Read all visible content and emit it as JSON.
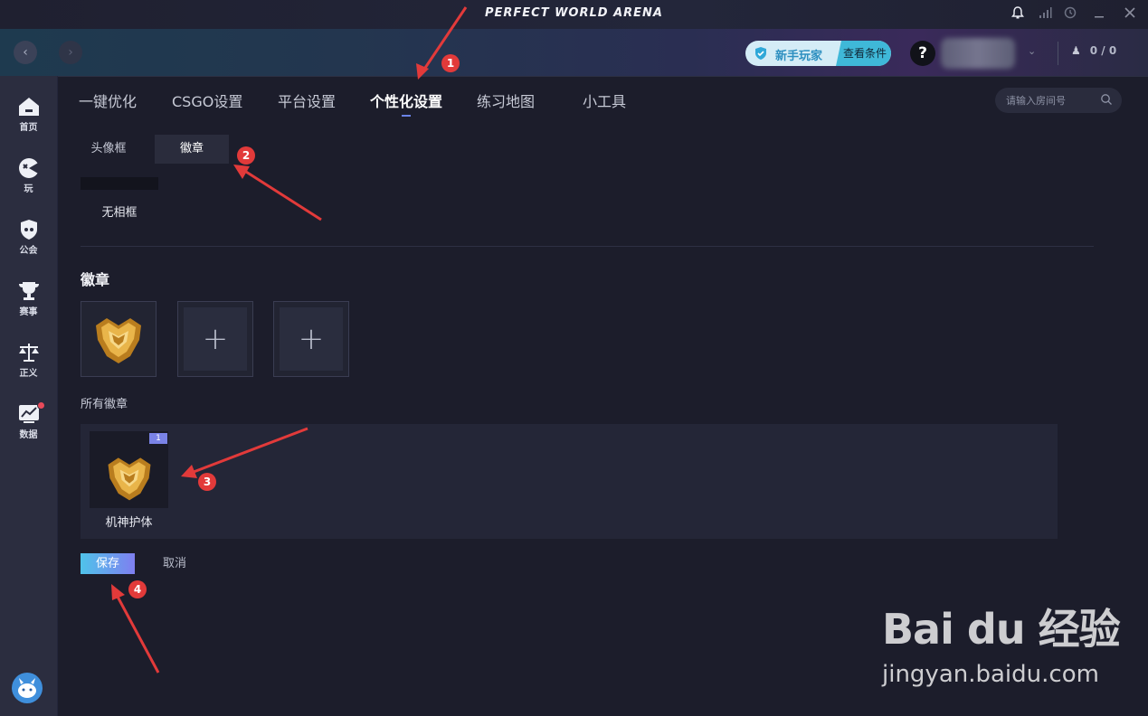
{
  "app": {
    "title": "PERFECT WORLD ARENA"
  },
  "header": {
    "newbie_label": "新手玩家",
    "newbie_condition": "查看条件",
    "help_label": "?",
    "friends_count": "0 / 0"
  },
  "sidebar": {
    "items": [
      {
        "label": "首页",
        "icon": "home-icon"
      },
      {
        "label": "玩",
        "icon": "play-icon"
      },
      {
        "label": "公会",
        "icon": "guild-icon"
      },
      {
        "label": "赛事",
        "icon": "trophy-icon"
      },
      {
        "label": "正义",
        "icon": "justice-scale-icon"
      },
      {
        "label": "数据",
        "icon": "data-chart-icon"
      }
    ]
  },
  "main_tabs": [
    {
      "label": "一键优化"
    },
    {
      "label": "CSGO设置"
    },
    {
      "label": "平台设置"
    },
    {
      "label": "个性化设置",
      "active": true
    },
    {
      "label": "练习地图"
    },
    {
      "label": "小工具"
    }
  ],
  "search": {
    "placeholder": "请输入房间号"
  },
  "sub_tabs": [
    {
      "label": "头像框"
    },
    {
      "label": "徽章",
      "active": true
    }
  ],
  "frame": {
    "label": "无相框"
  },
  "badges": {
    "section_title": "徽章",
    "all_label": "所有徽章",
    "items": [
      {
        "name": "机神护体",
        "count": "1"
      }
    ]
  },
  "actions": {
    "save": "保存",
    "cancel": "取消"
  },
  "annotations": [
    "1",
    "2",
    "3",
    "4"
  ],
  "watermark": {
    "logo": "Bai du 经验",
    "url": "jingyan.baidu.com"
  },
  "colors": {
    "accent": "#6b83e8",
    "annotation": "#e23a3a",
    "badge_gold": "#d9a23a"
  }
}
